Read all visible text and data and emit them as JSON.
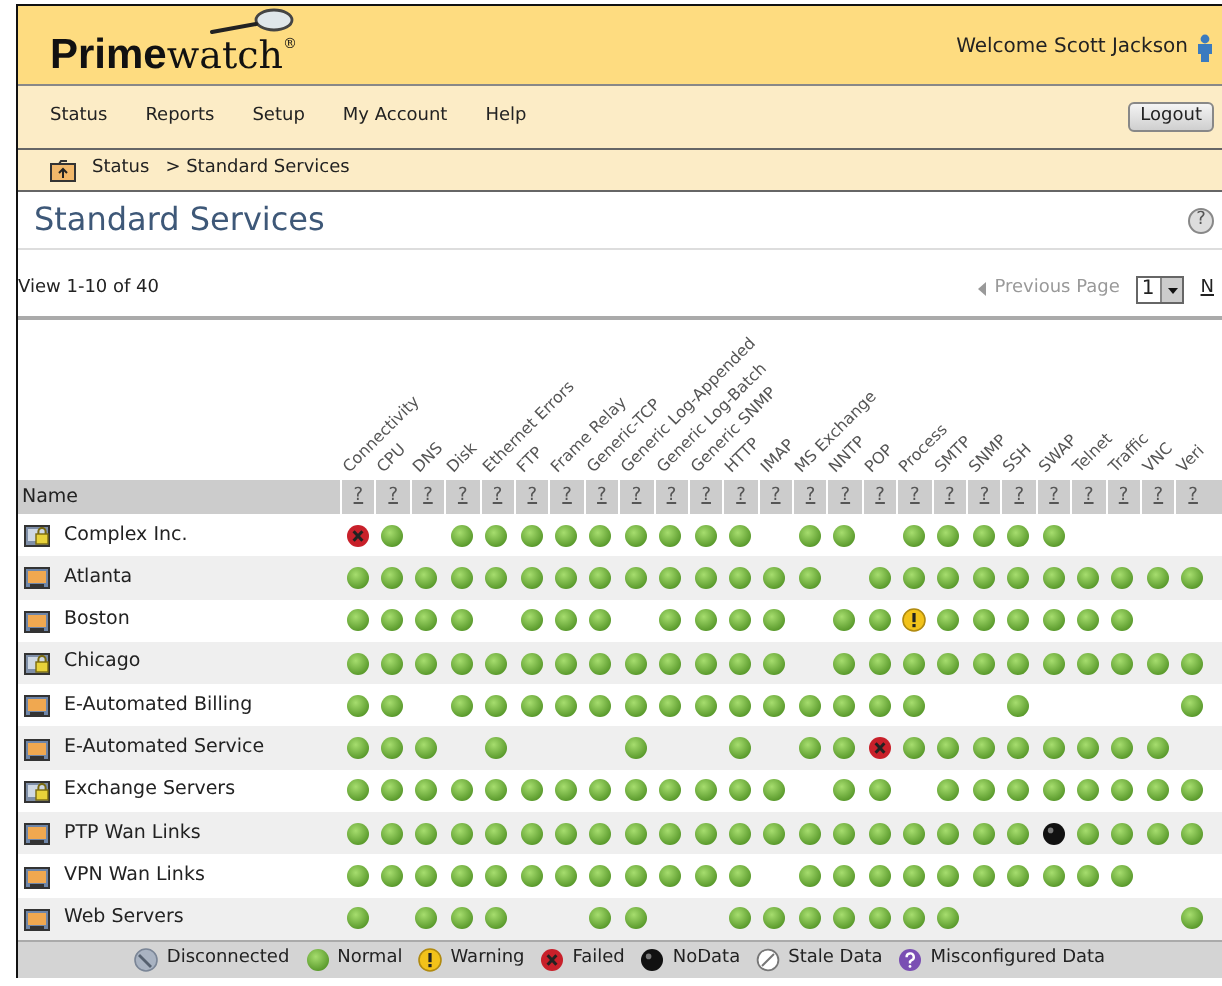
{
  "header": {
    "logo": "**Prime**watch$^{®}$",
    "welcome": "Welcome Scott Jackson"
  },
  "nav": {
    "items": [
      "Status",
      "Reports",
      "Setup",
      "My Account",
      "Help"
    ],
    "logout": "Logout"
  },
  "breadcrumb": {
    "link": "Status",
    "current": "> Standard Services"
  },
  "page": {
    "title": "Standard Services",
    "help": "?"
  },
  "pager": {
    "view": "View 1-10 of 40",
    "previous": "Previous Page",
    "previous_disabled": true,
    "page": "1",
    "next": "N"
  },
  "table": {
    "name_heading": "Name",
    "columns": [
      "Connectivity",
      "CPU",
      "DNS",
      "Disk",
      "Ethernet Errors",
      "FTP",
      "Frame Relay",
      "Generic-TCP",
      "Generic Log-Appended",
      "Generic Log-Batch",
      "Generic SNMP",
      "HTTP",
      "IMAP",
      "MS Exchange",
      "NNTP",
      "POP",
      "Process",
      "SMTP",
      "SNMP",
      "SSH",
      "SWAP",
      "Telnet",
      "Traffic",
      "VNC",
      "Veri"
    ],
    "column_link": "?",
    "rows": [
      {
        "name": "Complex Inc.",
        "kind": "locked",
        "cells": [
          {
            "kind": "failed"
          },
          {
            "kind": "normal"
          },
          {
            "kind": "none"
          },
          {
            "kind": "normal"
          },
          {
            "kind": "normal"
          },
          {
            "kind": "normal"
          },
          {
            "kind": "normal"
          },
          {
            "kind": "normal"
          },
          {
            "kind": "normal"
          },
          {
            "kind": "normal"
          },
          {
            "kind": "normal"
          },
          {
            "kind": "normal"
          },
          {
            "kind": "none"
          },
          {
            "kind": "normal"
          },
          {
            "kind": "normal"
          },
          {
            "kind": "none"
          },
          {
            "kind": "normal"
          },
          {
            "kind": "normal"
          },
          {
            "kind": "normal"
          },
          {
            "kind": "normal"
          },
          {
            "kind": "normal"
          },
          {
            "kind": "none"
          },
          {
            "kind": "none"
          },
          {
            "kind": "none"
          },
          {
            "kind": "none"
          }
        ]
      },
      {
        "name": "Atlanta",
        "kind": "plain",
        "cells": [
          {
            "kind": "normal"
          },
          {
            "kind": "normal"
          },
          {
            "kind": "normal"
          },
          {
            "kind": "normal"
          },
          {
            "kind": "normal"
          },
          {
            "kind": "normal"
          },
          {
            "kind": "normal"
          },
          {
            "kind": "normal"
          },
          {
            "kind": "normal"
          },
          {
            "kind": "normal"
          },
          {
            "kind": "normal"
          },
          {
            "kind": "normal"
          },
          {
            "kind": "normal"
          },
          {
            "kind": "normal"
          },
          {
            "kind": "none"
          },
          {
            "kind": "normal"
          },
          {
            "kind": "normal"
          },
          {
            "kind": "normal"
          },
          {
            "kind": "normal"
          },
          {
            "kind": "normal"
          },
          {
            "kind": "normal"
          },
          {
            "kind": "normal"
          },
          {
            "kind": "normal"
          },
          {
            "kind": "normal"
          },
          {
            "kind": "normal"
          }
        ]
      },
      {
        "name": "Boston",
        "kind": "plain",
        "cells": [
          {
            "kind": "normal"
          },
          {
            "kind": "normal"
          },
          {
            "kind": "normal"
          },
          {
            "kind": "normal"
          },
          {
            "kind": "none"
          },
          {
            "kind": "normal"
          },
          {
            "kind": "normal"
          },
          {
            "kind": "normal"
          },
          {
            "kind": "none"
          },
          {
            "kind": "normal"
          },
          {
            "kind": "normal"
          },
          {
            "kind": "normal"
          },
          {
            "kind": "normal"
          },
          {
            "kind": "none"
          },
          {
            "kind": "normal"
          },
          {
            "kind": "normal"
          },
          {
            "kind": "warning"
          },
          {
            "kind": "normal"
          },
          {
            "kind": "normal"
          },
          {
            "kind": "normal"
          },
          {
            "kind": "normal"
          },
          {
            "kind": "normal"
          },
          {
            "kind": "normal"
          },
          {
            "kind": "none"
          },
          {
            "kind": "none"
          }
        ]
      },
      {
        "name": "Chicago",
        "kind": "locked",
        "cells": [
          {
            "kind": "normal"
          },
          {
            "kind": "normal"
          },
          {
            "kind": "normal"
          },
          {
            "kind": "normal"
          },
          {
            "kind": "normal"
          },
          {
            "kind": "normal"
          },
          {
            "kind": "normal"
          },
          {
            "kind": "normal"
          },
          {
            "kind": "normal"
          },
          {
            "kind": "normal"
          },
          {
            "kind": "normal"
          },
          {
            "kind": "normal"
          },
          {
            "kind": "normal"
          },
          {
            "kind": "none"
          },
          {
            "kind": "normal"
          },
          {
            "kind": "normal"
          },
          {
            "kind": "normal"
          },
          {
            "kind": "normal"
          },
          {
            "kind": "normal"
          },
          {
            "kind": "normal"
          },
          {
            "kind": "normal"
          },
          {
            "kind": "normal"
          },
          {
            "kind": "normal"
          },
          {
            "kind": "normal"
          },
          {
            "kind": "normal"
          }
        ]
      },
      {
        "name": "E-Automated Billing",
        "kind": "plain",
        "cells": [
          {
            "kind": "normal"
          },
          {
            "kind": "normal"
          },
          {
            "kind": "none"
          },
          {
            "kind": "normal"
          },
          {
            "kind": "normal"
          },
          {
            "kind": "normal"
          },
          {
            "kind": "normal"
          },
          {
            "kind": "normal"
          },
          {
            "kind": "normal"
          },
          {
            "kind": "normal"
          },
          {
            "kind": "normal"
          },
          {
            "kind": "normal"
          },
          {
            "kind": "normal"
          },
          {
            "kind": "normal"
          },
          {
            "kind": "normal"
          },
          {
            "kind": "normal"
          },
          {
            "kind": "normal"
          },
          {
            "kind": "none"
          },
          {
            "kind": "none"
          },
          {
            "kind": "normal"
          },
          {
            "kind": "none"
          },
          {
            "kind": "none"
          },
          {
            "kind": "none"
          },
          {
            "kind": "none"
          },
          {
            "kind": "normal"
          }
        ]
      },
      {
        "name": "E-Automated Service",
        "kind": "plain",
        "cells": [
          {
            "kind": "normal"
          },
          {
            "kind": "normal"
          },
          {
            "kind": "normal"
          },
          {
            "kind": "none"
          },
          {
            "kind": "normal"
          },
          {
            "kind": "none"
          },
          {
            "kind": "none"
          },
          {
            "kind": "none"
          },
          {
            "kind": "normal"
          },
          {
            "kind": "none"
          },
          {
            "kind": "none"
          },
          {
            "kind": "normal"
          },
          {
            "kind": "none"
          },
          {
            "kind": "normal"
          },
          {
            "kind": "normal"
          },
          {
            "kind": "failed"
          },
          {
            "kind": "normal"
          },
          {
            "kind": "normal"
          },
          {
            "kind": "normal"
          },
          {
            "kind": "normal"
          },
          {
            "kind": "normal"
          },
          {
            "kind": "normal"
          },
          {
            "kind": "normal"
          },
          {
            "kind": "normal"
          },
          {
            "kind": "none"
          }
        ]
      },
      {
        "name": "Exchange Servers",
        "kind": "locked",
        "cells": [
          {
            "kind": "normal"
          },
          {
            "kind": "normal"
          },
          {
            "kind": "normal"
          },
          {
            "kind": "normal"
          },
          {
            "kind": "normal"
          },
          {
            "kind": "normal"
          },
          {
            "kind": "normal"
          },
          {
            "kind": "normal"
          },
          {
            "kind": "normal"
          },
          {
            "kind": "normal"
          },
          {
            "kind": "normal"
          },
          {
            "kind": "normal"
          },
          {
            "kind": "normal"
          },
          {
            "kind": "none"
          },
          {
            "kind": "normal"
          },
          {
            "kind": "normal"
          },
          {
            "kind": "none"
          },
          {
            "kind": "normal"
          },
          {
            "kind": "normal"
          },
          {
            "kind": "normal"
          },
          {
            "kind": "normal"
          },
          {
            "kind": "normal"
          },
          {
            "kind": "normal"
          },
          {
            "kind": "normal"
          },
          {
            "kind": "normal"
          }
        ]
      },
      {
        "name": "PTP Wan Links",
        "kind": "plain",
        "cells": [
          {
            "kind": "normal"
          },
          {
            "kind": "normal"
          },
          {
            "kind": "normal"
          },
          {
            "kind": "normal"
          },
          {
            "kind": "normal"
          },
          {
            "kind": "normal"
          },
          {
            "kind": "normal"
          },
          {
            "kind": "normal"
          },
          {
            "kind": "normal"
          },
          {
            "kind": "normal"
          },
          {
            "kind": "normal"
          },
          {
            "kind": "normal"
          },
          {
            "kind": "normal"
          },
          {
            "kind": "normal"
          },
          {
            "kind": "normal"
          },
          {
            "kind": "normal"
          },
          {
            "kind": "normal"
          },
          {
            "kind": "normal"
          },
          {
            "kind": "normal"
          },
          {
            "kind": "normal"
          },
          {
            "kind": "nodata"
          },
          {
            "kind": "normal"
          },
          {
            "kind": "normal"
          },
          {
            "kind": "normal"
          },
          {
            "kind": "normal"
          }
        ]
      },
      {
        "name": "VPN Wan Links",
        "kind": "plain",
        "cells": [
          {
            "kind": "normal"
          },
          {
            "kind": "normal"
          },
          {
            "kind": "normal"
          },
          {
            "kind": "normal"
          },
          {
            "kind": "normal"
          },
          {
            "kind": "normal"
          },
          {
            "kind": "normal"
          },
          {
            "kind": "normal"
          },
          {
            "kind": "normal"
          },
          {
            "kind": "normal"
          },
          {
            "kind": "normal"
          },
          {
            "kind": "normal"
          },
          {
            "kind": "none"
          },
          {
            "kind": "normal"
          },
          {
            "kind": "normal"
          },
          {
            "kind": "normal"
          },
          {
            "kind": "normal"
          },
          {
            "kind": "normal"
          },
          {
            "kind": "normal"
          },
          {
            "kind": "normal"
          },
          {
            "kind": "normal"
          },
          {
            "kind": "normal"
          },
          {
            "kind": "normal"
          },
          {
            "kind": "none"
          },
          {
            "kind": "none"
          }
        ]
      },
      {
        "name": "Web Servers",
        "kind": "plain",
        "cells": [
          {
            "kind": "normal"
          },
          {
            "kind": "none"
          },
          {
            "kind": "normal"
          },
          {
            "kind": "normal"
          },
          {
            "kind": "normal"
          },
          {
            "kind": "none"
          },
          {
            "kind": "none"
          },
          {
            "kind": "normal"
          },
          {
            "kind": "normal"
          },
          {
            "kind": "none"
          },
          {
            "kind": "none"
          },
          {
            "kind": "normal"
          },
          {
            "kind": "normal"
          },
          {
            "kind": "normal"
          },
          {
            "kind": "normal"
          },
          {
            "kind": "normal"
          },
          {
            "kind": "normal"
          },
          {
            "kind": "normal"
          },
          {
            "kind": "none"
          },
          {
            "kind": "none"
          },
          {
            "kind": "none"
          },
          {
            "kind": "none"
          },
          {
            "kind": "none"
          },
          {
            "kind": "none"
          },
          {
            "kind": "normal"
          }
        ]
      }
    ]
  },
  "legend": [
    {
      "kind": "disconnected",
      "label": "Disconnected"
    },
    {
      "kind": "normal",
      "label": "Normal"
    },
    {
      "kind": "warning",
      "label": "Warning"
    },
    {
      "kind": "failed",
      "label": "Failed"
    },
    {
      "kind": "nodata",
      "label": "NoData"
    },
    {
      "kind": "stale",
      "label": "Stale Data"
    },
    {
      "kind": "misconfigured",
      "label": "Misconfigured Data"
    }
  ]
}
